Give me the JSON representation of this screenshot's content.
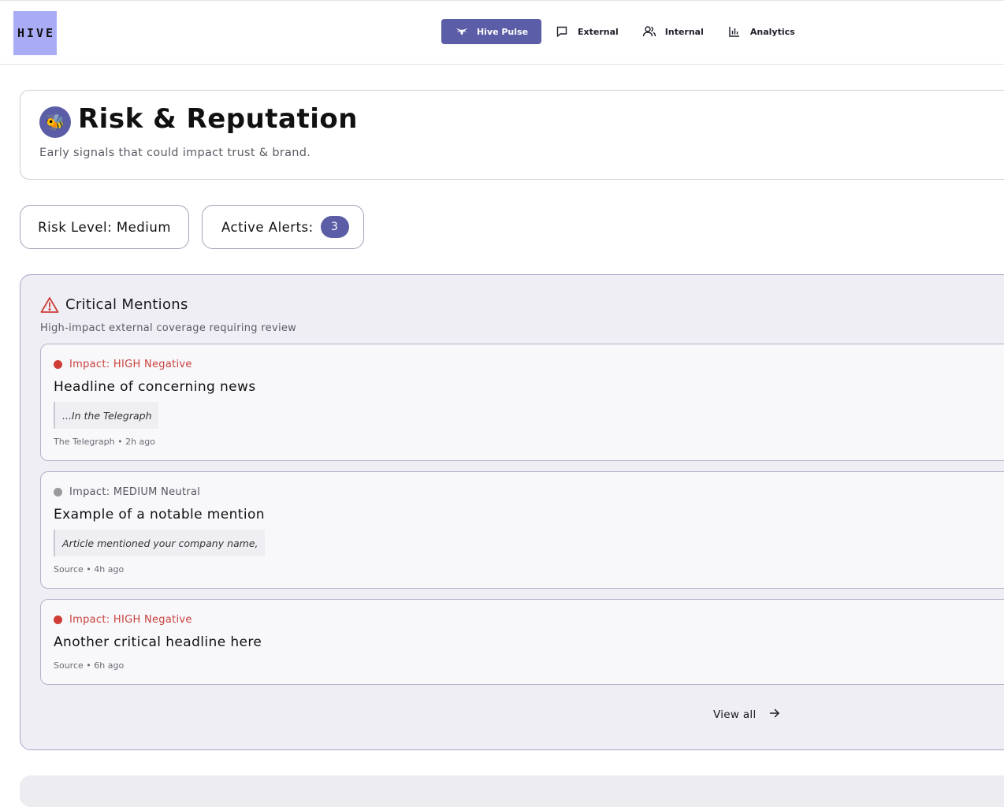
{
  "logo": {
    "text": "HIVE"
  },
  "nav": {
    "items": [
      {
        "label": "Hive Pulse",
        "icon": "bee-icon",
        "active": true
      },
      {
        "label": "External",
        "icon": "message-icon"
      },
      {
        "label": "Internal",
        "icon": "users-icon"
      },
      {
        "label": "Analytics",
        "icon": "bar-chart-icon"
      }
    ]
  },
  "header": {
    "avatar": "🐝",
    "title": "Risk & Reputation",
    "subtitle": "Early signals that could impact trust & brand."
  },
  "stats": {
    "risk_level": "Risk Level: Medium",
    "active_alerts_label": "Active Alerts:",
    "active_alerts_count": "3"
  },
  "critical": {
    "title": "Critical Mentions",
    "subtitle": "High-impact external coverage requiring review",
    "mentions": [
      {
        "impact": "Impact: HIGH Negative",
        "headline": "Headline of concerning news",
        "quote": "...In the Telegraph",
        "meta": "The Telegraph • 2h ago"
      },
      {
        "impact": "Impact: MEDIUM Neutral",
        "headline": "Example of a notable mention",
        "quote": "Article mentioned your company name,",
        "meta": "Source • 4h ago"
      },
      {
        "impact": "Impact: HIGH Negative",
        "headline": "Another critical headline here",
        "meta": "Source • 6h ago"
      }
    ],
    "view_all": "View all"
  },
  "colors": {
    "accent": "#5b5da6",
    "logo_bg": "#a9acf5",
    "high_negative": "#cf3d36",
    "medium_neutral": "#9a9a9e"
  }
}
